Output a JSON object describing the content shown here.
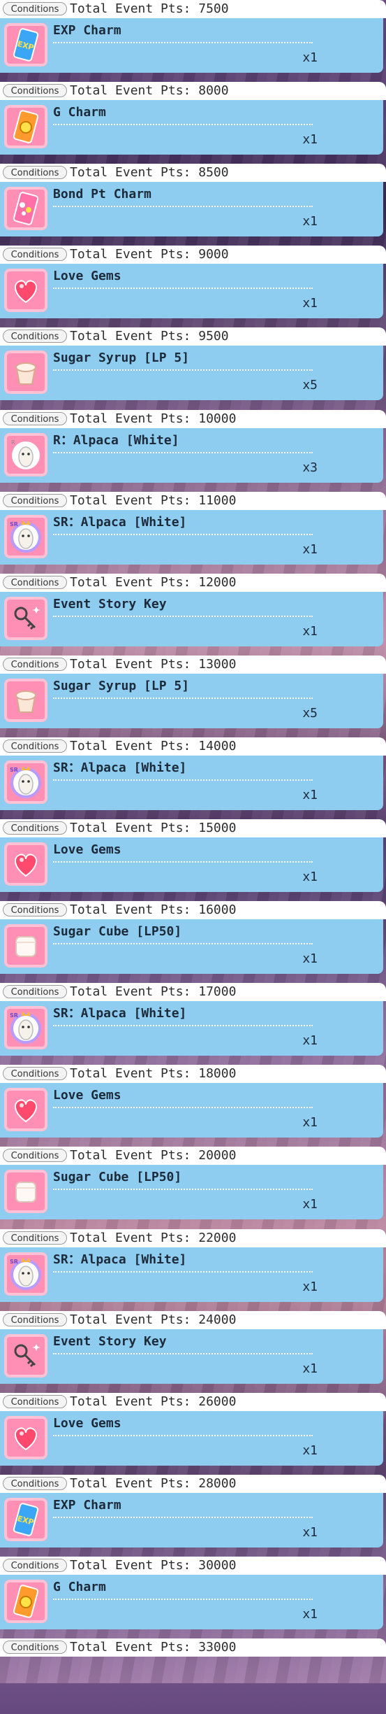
{
  "conditions_label": "Conditions",
  "rewards": [
    {
      "condition": "Total Event Pts: 7500",
      "item": "EXP Charm",
      "quantity": "x1",
      "icon": "exp-charm-icon"
    },
    {
      "condition": "Total Event Pts: 8000",
      "item": "G Charm",
      "quantity": "x1",
      "icon": "g-charm-icon"
    },
    {
      "condition": "Total Event Pts: 8500",
      "item": "Bond Pt Charm",
      "quantity": "x1",
      "icon": "bond-charm-icon"
    },
    {
      "condition": "Total Event Pts: 9000",
      "item": "Love Gems",
      "quantity": "x1",
      "icon": "love-gem-icon"
    },
    {
      "condition": "Total Event Pts: 9500",
      "item": "Sugar Syrup [LP 5]",
      "quantity": "x5",
      "icon": "sugar-syrup-icon"
    },
    {
      "condition": "Total Event Pts: 10000",
      "item": "R：Alpaca [White]",
      "quantity": "x3",
      "icon": "alpaca-r-icon"
    },
    {
      "condition": "Total Event Pts: 11000",
      "item": "SR：Alpaca [White]",
      "quantity": "x1",
      "icon": "alpaca-sr-icon"
    },
    {
      "condition": "Total Event Pts: 12000",
      "item": "Event Story Key",
      "quantity": "x1",
      "icon": "story-key-icon"
    },
    {
      "condition": "Total Event Pts: 13000",
      "item": "Sugar Syrup [LP 5]",
      "quantity": "x5",
      "icon": "sugar-syrup-icon"
    },
    {
      "condition": "Total Event Pts: 14000",
      "item": "SR：Alpaca [White]",
      "quantity": "x1",
      "icon": "alpaca-sr-icon"
    },
    {
      "condition": "Total Event Pts: 15000",
      "item": "Love Gems",
      "quantity": "x1",
      "icon": "love-gem-icon"
    },
    {
      "condition": "Total Event Pts: 16000",
      "item": "Sugar Cube [LP50]",
      "quantity": "x1",
      "icon": "sugar-cube-icon"
    },
    {
      "condition": "Total Event Pts: 17000",
      "item": "SR：Alpaca [White]",
      "quantity": "x1",
      "icon": "alpaca-sr-icon"
    },
    {
      "condition": "Total Event Pts: 18000",
      "item": "Love Gems",
      "quantity": "x1",
      "icon": "love-gem-icon"
    },
    {
      "condition": "Total Event Pts: 20000",
      "item": "Sugar Cube [LP50]",
      "quantity": "x1",
      "icon": "sugar-cube-icon"
    },
    {
      "condition": "Total Event Pts: 22000",
      "item": "SR：Alpaca [White]",
      "quantity": "x1",
      "icon": "alpaca-sr-icon"
    },
    {
      "condition": "Total Event Pts: 24000",
      "item": "Event Story Key",
      "quantity": "x1",
      "icon": "story-key-icon"
    },
    {
      "condition": "Total Event Pts: 26000",
      "item": "Love Gems",
      "quantity": "x1",
      "icon": "love-gem-icon"
    },
    {
      "condition": "Total Event Pts: 28000",
      "item": "EXP Charm",
      "quantity": "x1",
      "icon": "exp-charm-icon"
    },
    {
      "condition": "Total Event Pts: 30000",
      "item": "G Charm",
      "quantity": "x1",
      "icon": "g-charm-icon"
    },
    {
      "condition": "Total Event Pts: 33000",
      "item": "",
      "quantity": "",
      "icon": ""
    }
  ],
  "colors": {
    "card_body": "#8ecdf0",
    "card_head": "#ffffff",
    "icon_bg": "#ff8fb4",
    "text": "#1c2a3a"
  }
}
